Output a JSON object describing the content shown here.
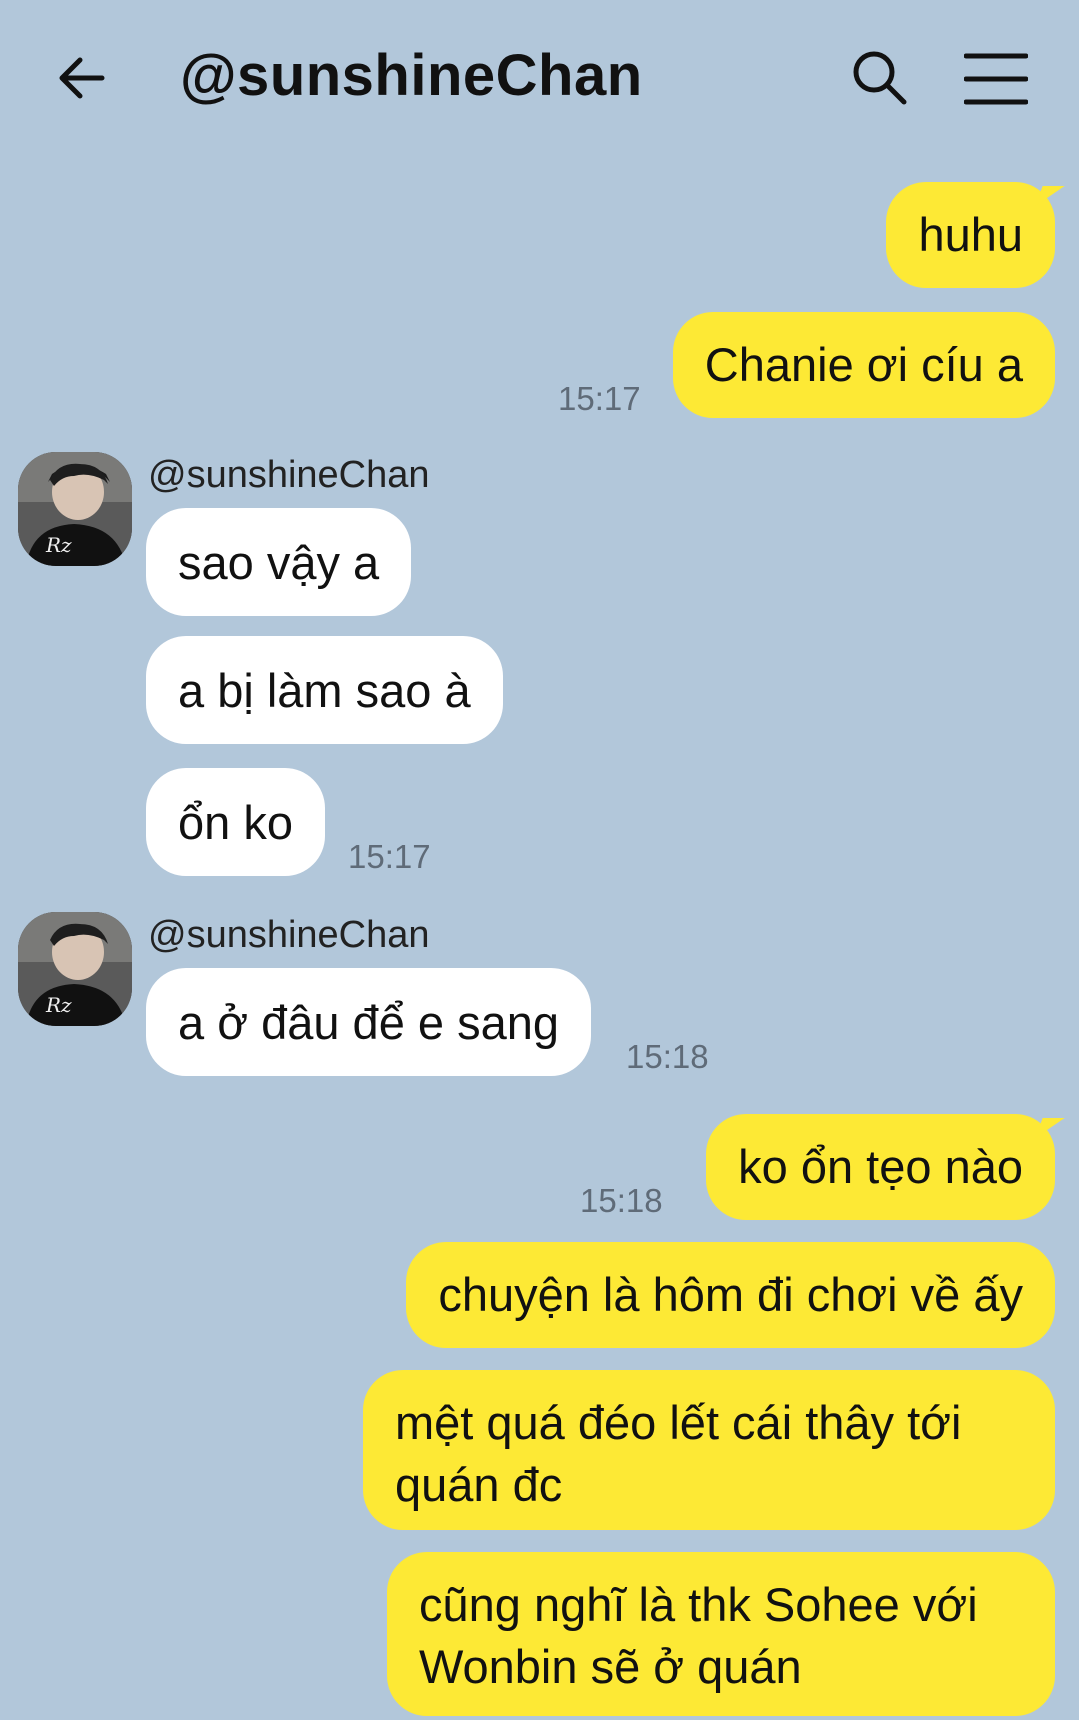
{
  "header": {
    "title": "@sunshineChan",
    "back_icon": "arrow-left-icon",
    "search_icon": "search-icon",
    "menu_icon": "hamburger-menu-icon"
  },
  "colors": {
    "background": "#b2c7da",
    "outgoing_bubble": "#fde935",
    "incoming_bubble": "#ffffff",
    "timestamp": "#5f6b78"
  },
  "messages": [
    {
      "dir": "out",
      "text": "huhu"
    },
    {
      "dir": "out",
      "text": "Chanie ơi cíu a",
      "time": "15:17"
    },
    {
      "dir": "in",
      "sender": "@sunshineChan",
      "text": "sao vậy a"
    },
    {
      "dir": "in",
      "text": "a bị làm sao à"
    },
    {
      "dir": "in",
      "text": "ổn ko",
      "time": "15:17"
    },
    {
      "dir": "in",
      "sender": "@sunshineChan",
      "text": "a ở đâu để e sang",
      "time": "15:18"
    },
    {
      "dir": "out",
      "text": "ko ổn tẹo nào",
      "time": "15:18"
    },
    {
      "dir": "out",
      "text": "chuyện là hôm đi chơi về ấy"
    },
    {
      "dir": "out",
      "text": "mệt quá đéo lết cái thây tới quán đc"
    },
    {
      "dir": "out",
      "text": "cũng nghĩ là thk Sohee với Wonbin sẽ ở quán"
    }
  ]
}
